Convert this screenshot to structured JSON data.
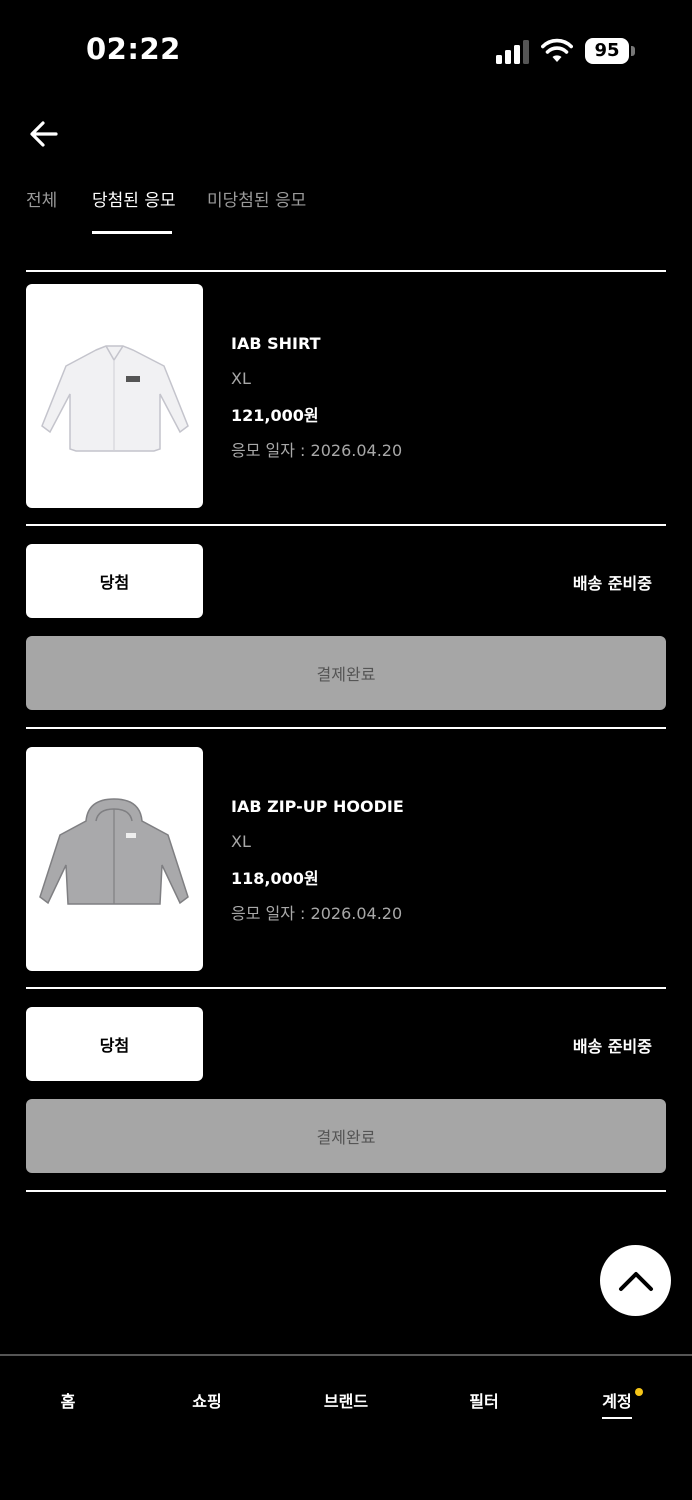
{
  "status_bar": {
    "time": "02:22",
    "battery": "95"
  },
  "tabs": [
    {
      "label": "전체"
    },
    {
      "label": "당첨된 응모"
    },
    {
      "label": "미당첨된 응모"
    }
  ],
  "entries": [
    {
      "name": "IAB SHIRT",
      "size": "XL",
      "price": "121,000원",
      "date": "응모 일자 : 2026.04.20",
      "result": "당첨",
      "shipping": "배송 준비중",
      "payment": "결제완료"
    },
    {
      "name": "IAB ZIP-UP HOODIE",
      "size": "XL",
      "price": "118,000원",
      "date": "응모 일자 : 2026.04.20",
      "result": "당첨",
      "shipping": "배송 준비중",
      "payment": "결제완료"
    }
  ],
  "nav": [
    {
      "label": "홈"
    },
    {
      "label": "쇼핑"
    },
    {
      "label": "브랜드"
    },
    {
      "label": "필터"
    },
    {
      "label": "계정"
    }
  ],
  "colors": {
    "notification_dot": "#f5c518",
    "payment_button": "#a6a6a6"
  }
}
